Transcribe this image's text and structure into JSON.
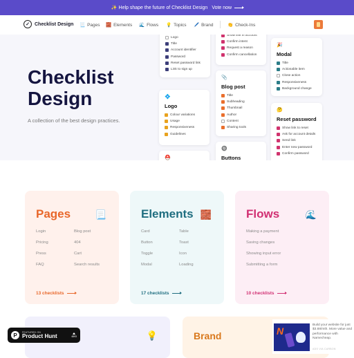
{
  "banner": {
    "text": "✨ Help shape the future of Checklist Design",
    "cta": "Vote now",
    "bg": "#5a4bc9"
  },
  "nav": {
    "logo": "Checklist Design",
    "items": [
      {
        "icon": "📃",
        "label": "Pages"
      },
      {
        "icon": "🧱",
        "label": "Elements"
      },
      {
        "icon": "🌊",
        "label": "Flows"
      },
      {
        "icon": "💡",
        "label": "Topics"
      },
      {
        "icon": "🖊️",
        "label": "Brand"
      },
      {
        "icon": "👏",
        "label": "Check-Ins"
      }
    ]
  },
  "hero": {
    "title_line1": "Checklist",
    "title_line2": "Design",
    "subtitle": "A collection of the best design practices."
  },
  "mock_cards": {
    "login": {
      "items": [
        {
          "label": "Logo",
          "checked": false
        },
        {
          "label": "Title",
          "checked": true
        },
        {
          "label": "Account identifier",
          "checked": true
        },
        {
          "label": "Password",
          "checked": true
        },
        {
          "label": "Reset password link",
          "checked": true
        },
        {
          "label": "Link to sign up",
          "checked": true
        }
      ],
      "color": "#3d3f7a"
    },
    "cancel": {
      "items": [
        {
          "label": "Show link in account",
          "checked": true
        },
        {
          "label": "Confirm intent",
          "checked": true
        },
        {
          "label": "Request a reason",
          "checked": true
        },
        {
          "label": "Confirm cancellation",
          "checked": true
        }
      ],
      "color": "#d0336e"
    },
    "logo": {
      "icon": "💠",
      "title": "Logo",
      "items": [
        {
          "label": "Colour variations",
          "checked": true
        },
        {
          "label": "Usage",
          "checked": true
        },
        {
          "label": "Responsiveness",
          "checked": true
        },
        {
          "label": "Guidelines",
          "checked": true
        }
      ],
      "color": "#e8a21e"
    },
    "blog": {
      "icon": "📎",
      "title": "Blog post",
      "items": [
        {
          "label": "Title",
          "checked": true
        },
        {
          "label": "Subheading",
          "checked": true
        },
        {
          "label": "Thumbnail",
          "checked": true
        },
        {
          "label": "Author",
          "checked": true
        },
        {
          "label": "Content",
          "checked": false
        },
        {
          "label": "Sharing tools",
          "checked": true
        }
      ],
      "color": "#ea6f2d"
    },
    "modal": {
      "icon": "🎉",
      "title": "Modal",
      "items": [
        {
          "label": "Title",
          "checked": true
        },
        {
          "label": "Actionable item",
          "checked": true
        },
        {
          "label": "Close action",
          "checked": false
        },
        {
          "label": "Responsiveness",
          "checked": true
        },
        {
          "label": "Background change",
          "checked": true
        }
      ],
      "color": "#2c7d88"
    },
    "reset": {
      "icon": "🤔",
      "title": "Reset password",
      "items": [
        {
          "label": "Show link to reset",
          "checked": true
        },
        {
          "label": "Ask for account details",
          "checked": true
        },
        {
          "label": "Send link",
          "checked": true
        },
        {
          "label": "Enter new password",
          "checked": true
        },
        {
          "label": "Confirm password",
          "checked": true
        }
      ],
      "color": "#d0336e"
    },
    "buttons": {
      "icon": "🔘",
      "title": "Buttons"
    },
    "extra": {
      "icon": "⛑️"
    }
  },
  "categories": [
    {
      "title": "Pages",
      "emoji": "📃",
      "color": "#e8672a",
      "bg": "#fff1ec",
      "col1": [
        "Login",
        "Pricing",
        "Press",
        "FAQ"
      ],
      "col2": [
        "Blog post",
        "404",
        "Cart",
        "Search results"
      ],
      "count": "13 checklists"
    },
    {
      "title": "Elements",
      "emoji": "🧱",
      "color": "#1f6e80",
      "bg": "#eef8f9",
      "col1": [
        "Card",
        "Button",
        "Toggle",
        "Modal"
      ],
      "col2": [
        "Table",
        "Toast",
        "Icon",
        "Loading"
      ],
      "count": "17 checklists"
    },
    {
      "title": "Flows",
      "emoji": "🌊",
      "color": "#d12f72",
      "bg": "#fdeef5",
      "col1": [
        "Making a payment",
        "Saving changes",
        "Showing input error",
        "Submitting a form"
      ],
      "col2": [],
      "count": "10 checklists"
    },
    {
      "title": "",
      "emoji": "💡",
      "color": "#5a4bc9",
      "bg": "#f1f0fc"
    },
    {
      "title": "Brand",
      "emoji": "",
      "color": "#d9781c",
      "bg": "#fff3e6"
    }
  ],
  "producthunt": {
    "featured": "FEATURED ON",
    "name": "Product Hunt",
    "votes": "4893"
  },
  "ad": {
    "text": "Build your website for just $3.88/mth. More value and performance with Namecheap.",
    "small": "ADS VIA CARBON"
  }
}
